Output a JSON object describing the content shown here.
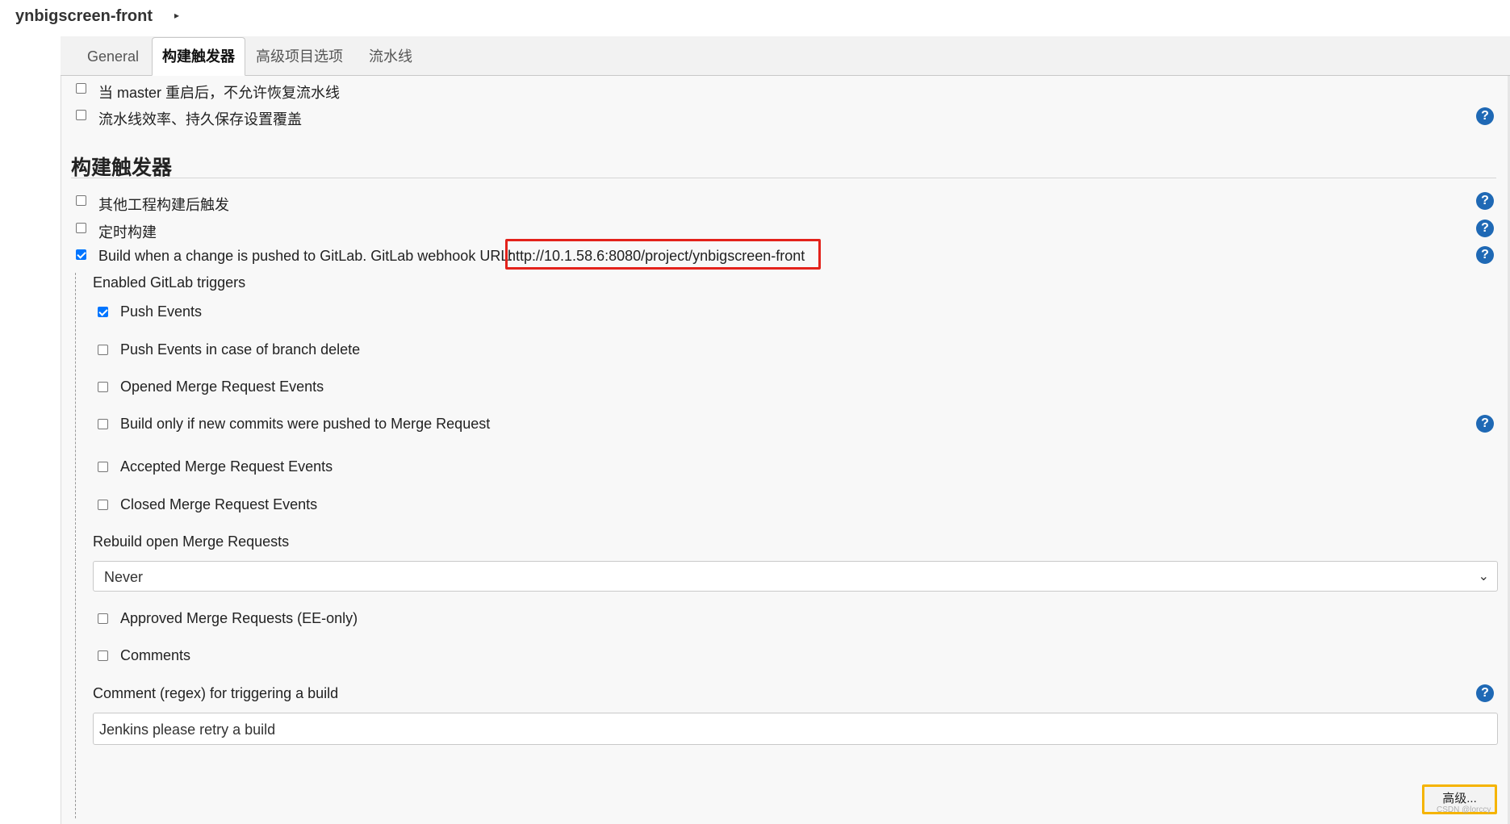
{
  "header": {
    "project_name": "ynbigscreen-front",
    "caret": "▸"
  },
  "tabs": [
    "General",
    "构建触发器",
    "高级项目选项",
    "流水线"
  ],
  "general_options": [
    {
      "label": "当 master 重启后，不允许恢复流水线",
      "checked": false
    },
    {
      "label": "流水线效率、持久保存设置覆盖",
      "checked": false
    }
  ],
  "section": {
    "title": "构建触发器"
  },
  "triggers": [
    {
      "label": "其他工程构建后触发",
      "checked": false
    },
    {
      "label": "定时构建",
      "checked": false
    },
    {
      "label": "Build when a change is pushed to GitLab. GitLab webhook URL:",
      "checked": true
    }
  ],
  "webhook_url": "http://10.1.58.6:8080/project/ynbigscreen-front",
  "gitlab": {
    "enabled_triggers_label": "Enabled GitLab triggers",
    "events": [
      {
        "label": "Push Events",
        "checked": true
      },
      {
        "label": "Push Events in case of branch delete",
        "checked": false
      },
      {
        "label": "Opened Merge Request Events",
        "checked": false
      },
      {
        "label": "Build only if new commits were pushed to Merge Request",
        "checked": false
      },
      {
        "label": "Accepted Merge Request Events",
        "checked": false
      },
      {
        "label": "Closed Merge Request Events",
        "checked": false
      }
    ],
    "rebuild_label": "Rebuild open Merge Requests",
    "rebuild_value": "Never",
    "extra": [
      {
        "label": "Approved Merge Requests (EE-only)",
        "checked": false
      },
      {
        "label": "Comments",
        "checked": false
      }
    ],
    "comment_regex_label": "Comment (regex) for triggering a build",
    "comment_regex_value": "Jenkins please retry a build"
  },
  "help_icon_glyph": "?",
  "chevron_glyph": "⌄",
  "advanced_button": "高级...",
  "watermark": "CSDN @lorccy"
}
